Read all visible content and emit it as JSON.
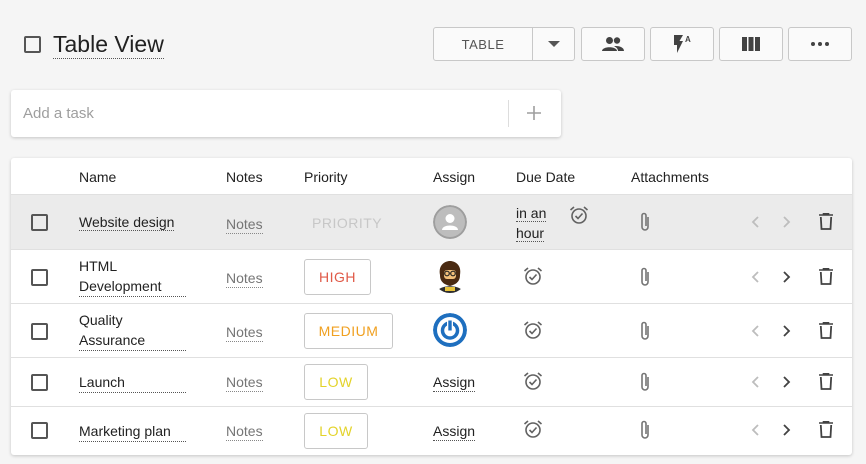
{
  "header": {
    "title": "Table View",
    "view_select_label": "TABLE",
    "icons": [
      "checkbox-icon",
      "chevron-down-icon",
      "users-icon",
      "flash-auto-icon",
      "columns-icon",
      "more-horiz-icon"
    ]
  },
  "add_task": {
    "placeholder": "Add a task",
    "icon": "plus-icon"
  },
  "table": {
    "columns": [
      "Name",
      "Notes",
      "Priority",
      "Assign",
      "Due Date",
      "Attachments"
    ],
    "rows": [
      {
        "name_lines": [
          "Website design"
        ],
        "notes": "Notes",
        "priority": "PRIORITY",
        "priority_color": "#c7c7c7",
        "assign": "",
        "avatar": "default-avatar-icon",
        "due_lines": [
          "in an",
          "hour"
        ],
        "selected": true
      },
      {
        "name_lines": [
          "HTML",
          "Development"
        ],
        "notes": "Notes",
        "priority": "HIGH",
        "priority_color": "#e05a48",
        "assign": "",
        "avatar": "bearded-person-avatar",
        "due_lines": [],
        "selected": false
      },
      {
        "name_lines": [
          "Quality",
          "Assurance"
        ],
        "notes": "Notes",
        "priority": "MEDIUM",
        "priority_color": "#f0a020",
        "assign": "",
        "avatar": "power-logo-avatar",
        "due_lines": [],
        "selected": false
      },
      {
        "name_lines": [
          "Launch"
        ],
        "notes": "Notes",
        "priority": "LOW",
        "priority_color": "#e3d32a",
        "assign": "Assign",
        "avatar": "",
        "due_lines": [],
        "selected": false
      },
      {
        "name_lines": [
          "Marketing plan"
        ],
        "notes": "Notes",
        "priority": "LOW",
        "priority_color": "#e3d32a",
        "assign": "Assign",
        "avatar": "",
        "due_lines": [],
        "selected": false
      }
    ],
    "row_icons": [
      "alarm-icon",
      "paperclip-icon",
      "chevron-left-icon",
      "chevron-right-icon",
      "trash-icon"
    ]
  }
}
